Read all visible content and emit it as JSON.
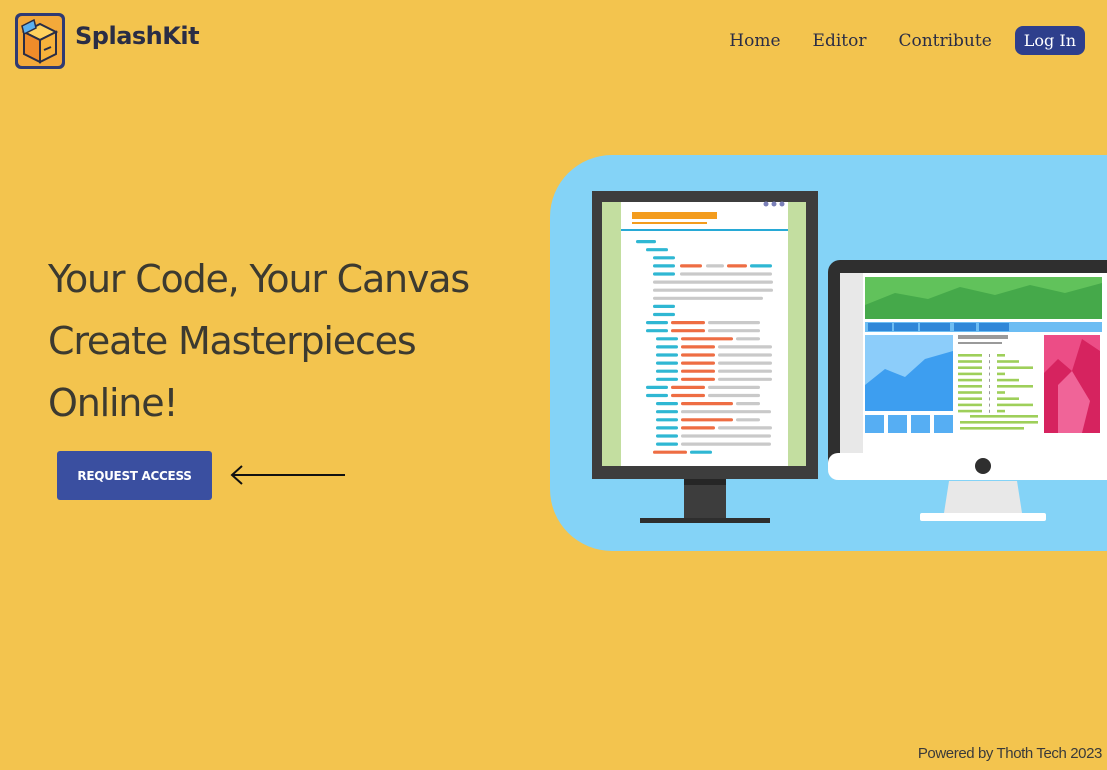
{
  "header": {
    "brand": "SplashKit",
    "logo_icon": "box-package-icon",
    "nav": [
      "Home",
      "Editor",
      "Contribute"
    ],
    "login_label": "Log In"
  },
  "hero": {
    "lines": [
      "Your Code, Your Canvas",
      "Create Masterpieces",
      "Online!"
    ],
    "cta_label": "REQUEST ACCESS",
    "arrow_icon": "left-arrow-icon",
    "illustration_icon": "monitors-illustration"
  },
  "footer": {
    "text": "Powered by Thoth Tech 2023"
  },
  "colors": {
    "background": "#f3c44e",
    "nav_text": "#2a2d45",
    "login_bg": "#2e3f8c",
    "cta_bg": "#3a4fa0",
    "illustration_bg": "#84d3f7"
  }
}
